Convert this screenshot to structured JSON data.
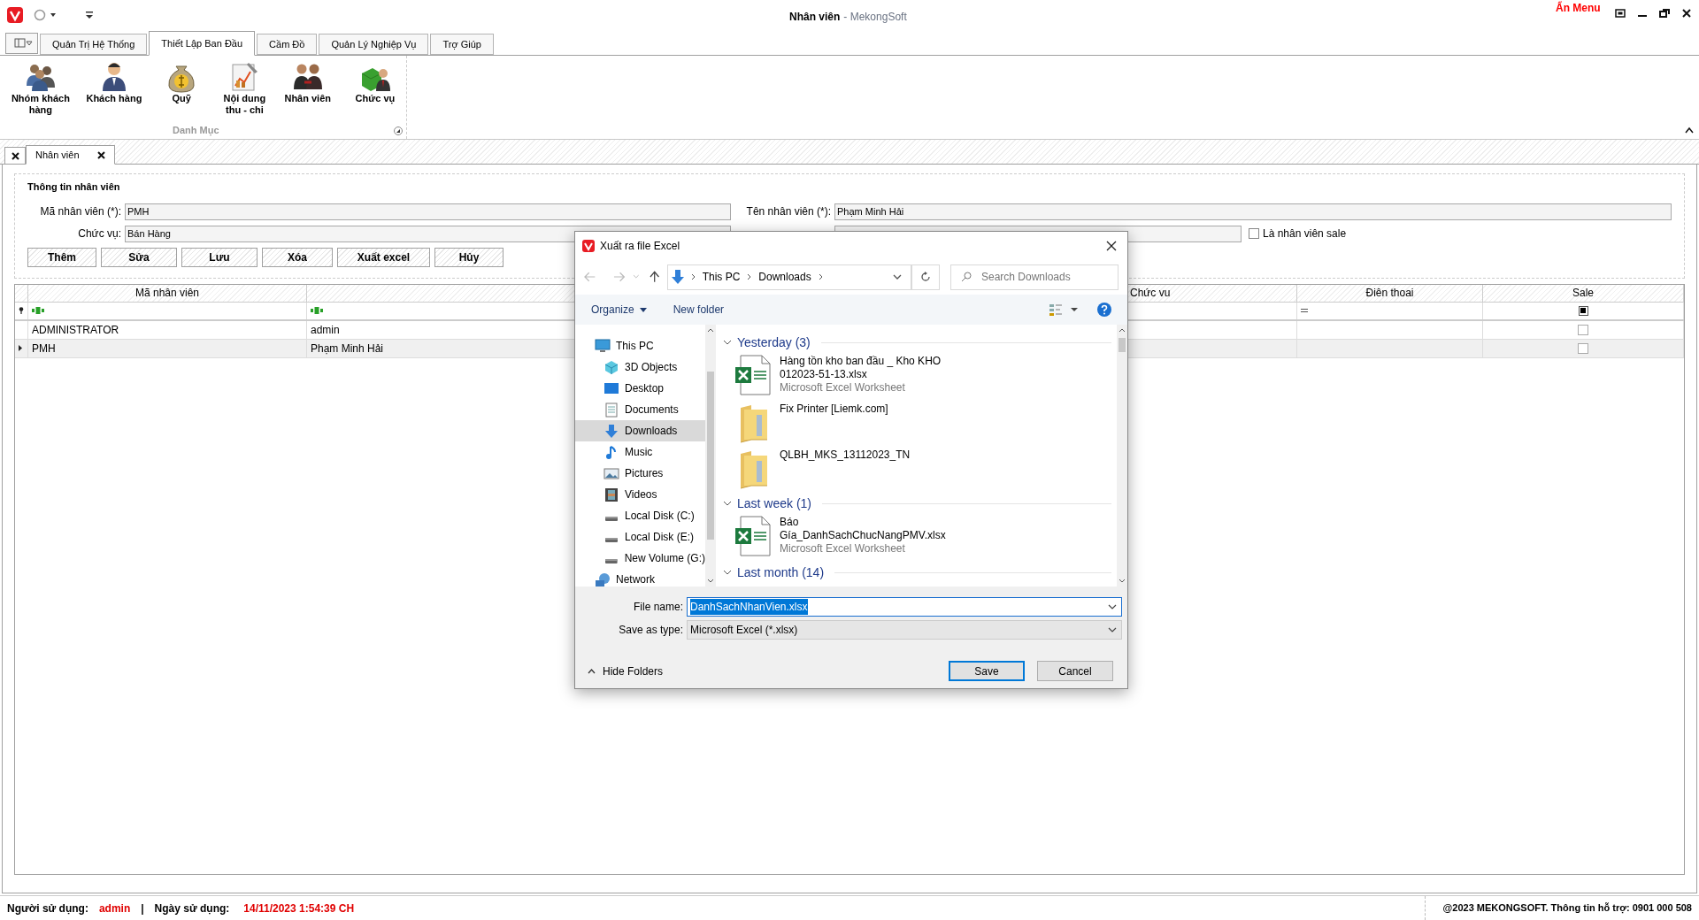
{
  "app": {
    "title": "Nhân viên",
    "subtitle": "- MekongSoft",
    "hide_menu": "Ẩn Menu"
  },
  "ribbon_tabs": [
    {
      "label": "Quản Trị Hệ Thống",
      "selected": false
    },
    {
      "label": "Thiết Lập Ban Đầu",
      "selected": true
    },
    {
      "label": "Cầm Đồ",
      "selected": false
    },
    {
      "label": "Quản Lý Nghiệp Vụ",
      "selected": false
    },
    {
      "label": "Trợ Giúp",
      "selected": false
    }
  ],
  "ribbon_buttons": [
    {
      "label": "Nhóm khách hàng",
      "kind": "group"
    },
    {
      "label": "Khách hàng",
      "kind": "person"
    },
    {
      "label": "Quỹ",
      "kind": "money"
    },
    {
      "label": "Nội dung thu - chi",
      "kind": "notes"
    },
    {
      "label": "Nhân viên",
      "kind": "pair"
    },
    {
      "label": "Chức vụ",
      "kind": "role"
    }
  ],
  "ribbon_group": "Danh Mục",
  "doc_tabs": [
    {
      "label": "Nhân viên",
      "selected": true
    }
  ],
  "form": {
    "title": "Thông tin nhân viên",
    "code": {
      "label": "Mã nhân viên (*):",
      "value": "PMH"
    },
    "name": {
      "label": "Tên nhân viên (*):",
      "value": "Phạm Minh Hải"
    },
    "role": {
      "label": "Chức vụ:",
      "value": "Bán Hàng"
    },
    "sale": {
      "label": "Là nhân viên sale",
      "checked": false
    },
    "buttons": [
      "Thêm",
      "Sửa",
      "Lưu",
      "Xóa",
      "Xuất excel",
      "Hủy"
    ]
  },
  "grid": {
    "columns": [
      {
        "label": "Mã nhân viên"
      },
      {
        "label": "Chức vu"
      },
      {
        "label": "Điên thoai"
      },
      {
        "label": "Sale"
      }
    ],
    "filter_sale_checked": true,
    "rows": [
      {
        "code": "ADMINISTRATOR",
        "name": "admin",
        "sale": false,
        "selected": false
      },
      {
        "code": "PMH",
        "name": "Phạm Minh Hải",
        "sale": false,
        "selected": true
      }
    ]
  },
  "dialog": {
    "title": "Xuất ra file Excel",
    "path": [
      "This PC",
      "Downloads"
    ],
    "search_placeholder": "Search Downloads",
    "toolbar": [
      "Organize",
      "New folder"
    ],
    "nav": [
      {
        "label": "This PC",
        "kind": "pc",
        "selected": false
      },
      {
        "label": "3D Objects",
        "kind": "cube",
        "selected": false
      },
      {
        "label": "Desktop",
        "kind": "desktop",
        "selected": false
      },
      {
        "label": "Documents",
        "kind": "doc",
        "selected": false
      },
      {
        "label": "Downloads",
        "kind": "download",
        "selected": true
      },
      {
        "label": "Music",
        "kind": "music",
        "selected": false
      },
      {
        "label": "Pictures",
        "kind": "pictures",
        "selected": false
      },
      {
        "label": "Videos",
        "kind": "videos",
        "selected": false
      },
      {
        "label": "Local Disk (C:)",
        "kind": "disk",
        "selected": false
      },
      {
        "label": "Local Disk (E:)",
        "kind": "disk",
        "selected": false
      },
      {
        "label": "New Volume (G:)",
        "kind": "disk",
        "selected": false
      },
      {
        "label": "Network",
        "kind": "network",
        "selected": false
      }
    ],
    "groups": [
      {
        "header": "Yesterday (3)",
        "files": [
          {
            "name": "Hàng tồn kho ban đầu _ Kho KHO 012023-51-13.xlsx",
            "type": "Microsoft Excel Worksheet",
            "kind": "excel"
          },
          {
            "name": "Fix Printer [Liemk.com]",
            "kind": "folder"
          },
          {
            "name": "QLBH_MKS_13112023_TN",
            "kind": "folder"
          }
        ]
      },
      {
        "header": "Last week (1)",
        "files": [
          {
            "name": "Báo Gía_DanhSachChucNangPMV.xlsx",
            "type": "Microsoft Excel Worksheet",
            "kind": "excel"
          }
        ]
      },
      {
        "header": "Last month (14)"
      }
    ],
    "file_name_label": "File name:",
    "file_name": "DanhSachNhanVien.xlsx",
    "type_label": "Save as type:",
    "type": "Microsoft Excel (*.xlsx)",
    "hide_folders": "Hide Folders",
    "save": "Save",
    "cancel": "Cancel"
  },
  "status": {
    "user_label": "Người sử dụng:",
    "user": "admin",
    "sep": "|",
    "date_label": "Ngày sử dụng:",
    "date": "14/11/2023 1:54:39 CH",
    "copyright": "@2023 MEKONGSOFT. Thông tin hỗ trợ: 0901 000 508"
  }
}
